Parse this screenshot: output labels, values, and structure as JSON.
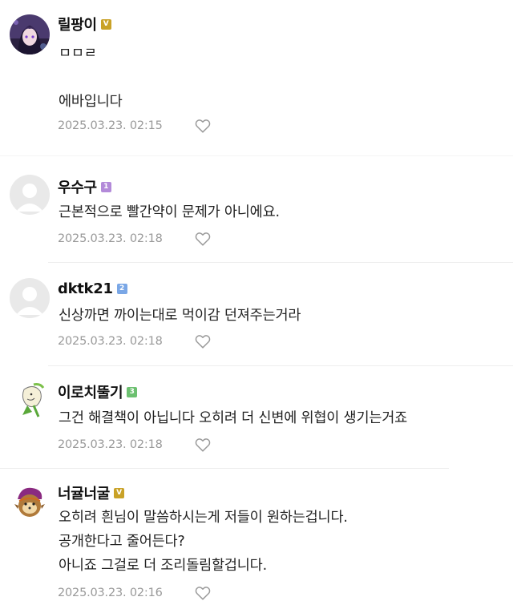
{
  "comments": [
    {
      "nickname": "릴팡이",
      "badge": {
        "glyph": "V",
        "color": "#c9a227"
      },
      "text": "ㅁㅁㄹ\n\n에바입니다",
      "date": "2025.03.23. 02:15",
      "like_icon": "heart-outline-icon"
    },
    {
      "nickname": "우수구",
      "badge": {
        "glyph": "1",
        "color": "#b38ad9"
      },
      "text": "근본적으로 빨간약이 문제가 아니에요.",
      "date": "2025.03.23. 02:18",
      "like_icon": "heart-outline-icon"
    },
    {
      "nickname": "dktk21",
      "badge": {
        "glyph": "2",
        "color": "#7aa7e6"
      },
      "text": "신상까면 까이는대로 먹이감 던져주는거라",
      "date": "2025.03.23. 02:18",
      "like_icon": "heart-outline-icon"
    },
    {
      "nickname": "이로치뚤기",
      "badge": {
        "glyph": "3",
        "color": "#6cc070"
      },
      "text": "그건 해결책이 아닙니다 오히려 더 신변에 위협이 생기는거죠",
      "date": "2025.03.23. 02:18",
      "like_icon": "heart-outline-icon"
    },
    {
      "nickname": "너귤너굴",
      "badge": {
        "glyph": "V",
        "color": "#c9a227"
      },
      "text": "오히려 흰님이 말씀하시는게 저들이 원하는겁니다.\n공개한다고 줄어든다?\n아니죠 그걸로 더 조리돌림할겁니다.",
      "date": "2025.03.23. 02:16",
      "like_icon": "heart-outline-icon"
    }
  ],
  "colors": {
    "nickname": "#111111",
    "text": "#222222",
    "date": "#999999",
    "heart_stroke": "#999999",
    "divider": "#ededed"
  }
}
